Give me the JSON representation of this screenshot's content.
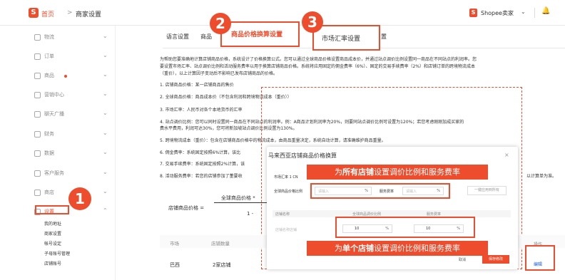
{
  "header": {
    "logo": "S",
    "breadcrumb_home": "首页",
    "breadcrumb_sep": ">",
    "breadcrumb_current": "商家设置",
    "seller_logo": "S",
    "seller_label": "Shopee卖家",
    "seller_chevron": "⌄",
    "bell_icon": "🔔"
  },
  "sidebar": {
    "items": [
      {
        "label": "物流",
        "chevron": "⌄"
      },
      {
        "label": "订单",
        "chevron": "⌄"
      },
      {
        "label": "商品",
        "chevron": "⌄"
      },
      {
        "label": "营销中心",
        "chevron": "⌄"
      },
      {
        "label": "聊天广播",
        "chevron": "⌄"
      },
      {
        "label": "财务",
        "chevron": "⌄"
      },
      {
        "label": "数据",
        "chevron": "⌄"
      },
      {
        "label": "客户服务",
        "chevron": "⌄"
      },
      {
        "label": "商店",
        "chevron": "⌄"
      },
      {
        "label": "设置",
        "chevron": "⌃"
      }
    ],
    "sub_items": [
      "我的地址",
      "商家设置",
      "帐号设定",
      "子母账号管理",
      "店铺账号"
    ]
  },
  "tabs": {
    "t1": "语言设置",
    "t2_partial": "商品",
    "active": "商品价格换算设置",
    "exchange": "市场汇率设置",
    "t5_partial": "置"
  },
  "steps": {
    "s1": "1",
    "s2": "2",
    "s3": "3"
  },
  "content": {
    "intro_1": "为帮助您要准确地计算店铺商品价格，系统设计了价格换算公式。您可以通过全球商品价格设置商品成本价，并通过站点调价比例设置同一商品在不同站点的利润率。您",
    "intro_2": "要设置市场汇率、站点调价比例和活动服务费率以用于换算店铺商品价格。系统将应用固定的佣金费率（6%）、固定的交易手续费率（2%）和店铺订单的跨境物流成本",
    "intro_3": "（重价），以上计算因子变动后不影响已发布店铺商品的价格。",
    "n1": "1. 店铺商品价格：某一店铺商品的售价",
    "n2": "2. 全球商品价格：商品成本价（不包含利润和跨境物流成本（重价））",
    "n3": "3. 市场汇率：人民币对各个本地货币的汇率",
    "n4": "4. 站点调价比例：您可以同时设置同一商品在不同站点的利润率。例：A商品计划利润率为20%，则要同站点调价比例可设置为120%；若您考虑刚刚加成买家的",
    "n4b": "费水平费用，利润可达30%，您可将新加坡站点调价比例设置为130%。",
    "n5": "5. 跨境物流成本（重价）：包含在店铺商品价格中的物流成本，由商品重量决定，系统自动计算，请准确维护商品重量。",
    "n6": "6. 佣金费率：系统固定按照6%计算，该比",
    "n7": "7. 交易手续费率：系统固定按照2%计算，该",
    "n8": "8. 活动服务费率：若您的店铺参加了董要收",
    "n8_tail": "以计算单为准。"
  },
  "formula": {
    "label": "店铺商品价格 =",
    "top": "全球商品价格 *",
    "bottom": "1 -"
  },
  "table": {
    "head_market": "市场",
    "head_count": "店铺数量",
    "head_op": "操作",
    "row_market": "巴西",
    "row_count": "2家店铺",
    "edit": "编辑"
  },
  "modal": {
    "title": "马来西亚店铺商品价格换算",
    "close": "×",
    "rate_label": "市场汇率 1 CN",
    "all_label": "全球商品价格比例",
    "ph_percent": "请输入",
    "unit_percent": "%",
    "fee_label": "服务费率",
    "ph_fee": "请输入",
    "apply_btn": "一键应用到所有",
    "col_shop": "店铺名称",
    "col_ratio": "全球商品调价比例",
    "col_fee": "服务费率",
    "row_shop": "店铺名称店铺",
    "row_ratio": "10",
    "row_fee": "10",
    "cancel": "取消",
    "save": "保存修改"
  },
  "banners": {
    "top_pre": "为",
    "top_bold": "所有店铺",
    "top_post": "设置调价比例和服务费率",
    "bottom_pre": "为",
    "bottom_bold": "单个店铺",
    "bottom_post": "设置调价比例和服务费率"
  },
  "colors": {
    "accent": "#ee4d2d",
    "link": "#1a5bd6"
  }
}
